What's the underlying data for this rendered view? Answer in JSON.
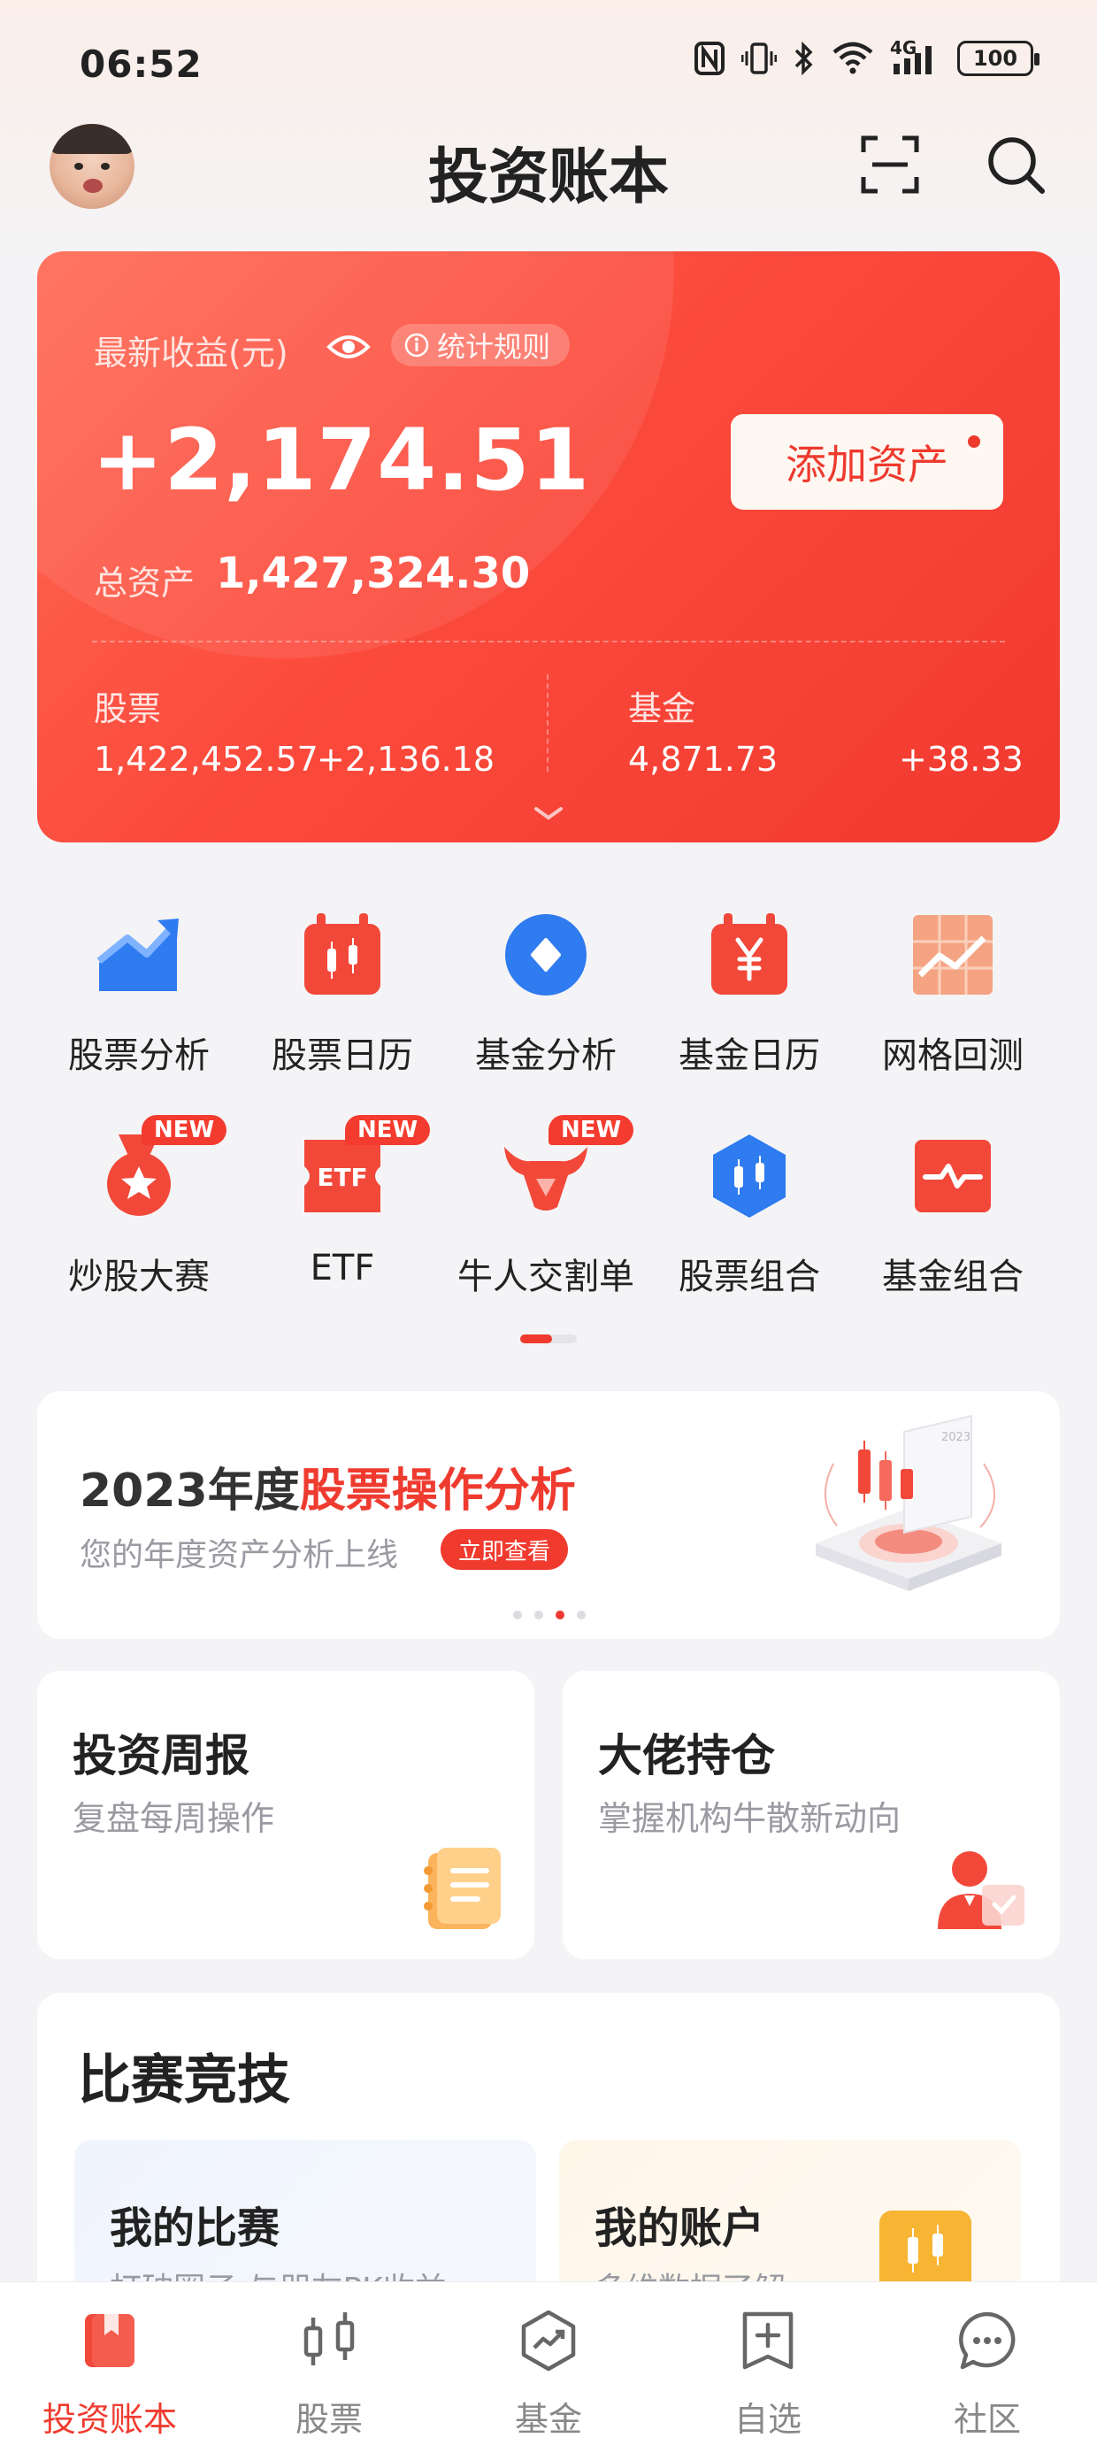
{
  "status_bar": {
    "time": "06:52",
    "network": "4G",
    "battery": "100",
    "icons": [
      "nfc-icon",
      "vibrate-icon",
      "bluetooth-icon",
      "wifi-icon",
      "signal-icon",
      "battery-icon"
    ]
  },
  "header": {
    "title": "投资账本",
    "icons": [
      "avatar",
      "scan-icon",
      "search-icon"
    ]
  },
  "asset_card": {
    "income_label": "最新收益(元)",
    "rules_label": "统计规则",
    "income_value": "+2,174.51",
    "add_asset_label": "添加资产",
    "total_label": "总资产",
    "total_value": "1,427,324.30",
    "stocks": {
      "label": "股票",
      "value": "1,422,452.57",
      "change": "+2,136.18"
    },
    "funds": {
      "label": "基金",
      "value": "4,871.73",
      "change": "+38.33"
    },
    "accent": "#f44336"
  },
  "shortcuts": {
    "row1": [
      {
        "label": "股票分析",
        "icon": "chart-up-icon"
      },
      {
        "label": "股票日历",
        "icon": "candle-calendar-icon"
      },
      {
        "label": "基金分析",
        "icon": "diamond-circle-icon"
      },
      {
        "label": "基金日历",
        "icon": "yen-calendar-icon"
      },
      {
        "label": "网格回测",
        "icon": "grid-chart-icon"
      }
    ],
    "row2": [
      {
        "label": "炒股大赛",
        "icon": "medal-icon",
        "badge": "NEW"
      },
      {
        "label": "ETF",
        "icon": "etf-ticket-icon",
        "badge": "NEW"
      },
      {
        "label": "牛人交割单",
        "icon": "bull-icon",
        "badge": "NEW"
      },
      {
        "label": "股票组合",
        "icon": "candle-hexagon-icon"
      },
      {
        "label": "基金组合",
        "icon": "pulse-box-icon"
      }
    ]
  },
  "banner": {
    "title_plain": "2023年度",
    "title_highlight": "股票操作分析",
    "subtitle": "您的年度资产分析上线",
    "button": "立即查看",
    "art_text": "2023"
  },
  "cards": [
    {
      "title": "投资周报",
      "subtitle": "复盘每周操作",
      "icon": "report-icon"
    },
    {
      "title": "大佬持仓",
      "subtitle": "掌握机构牛散新动向",
      "icon": "investor-icon"
    }
  ],
  "competition": {
    "heading": "比赛竞技",
    "tiles": [
      {
        "title": "我的比赛",
        "subtitle": "打破圈子 与朋友PK收益"
      },
      {
        "title": "我的账户",
        "subtitle": "多维数据了解"
      }
    ]
  },
  "bottom_nav": [
    {
      "label": "投资账本",
      "icon": "ledger-icon",
      "active": true
    },
    {
      "label": "股票",
      "icon": "stock-candle-icon",
      "active": false
    },
    {
      "label": "基金",
      "icon": "fund-trend-icon",
      "active": false
    },
    {
      "label": "自选",
      "icon": "watchlist-add-icon",
      "active": false
    },
    {
      "label": "社区",
      "icon": "chat-bubble-icon",
      "active": false
    }
  ]
}
